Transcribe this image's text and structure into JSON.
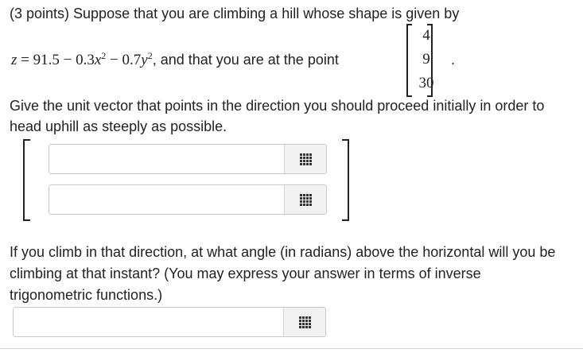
{
  "question": {
    "intro": "(3 points) Suppose that you are climbing a hill whose shape is given by",
    "equation": {
      "lhs": "z",
      "equals": " = 91.5 − 0.3",
      "var_x": "x",
      "exp_x": "2",
      "minus": " − 0.7",
      "var_y": "y",
      "exp_y": "2"
    },
    "point_text": ", and that you are at the point",
    "point": [
      "4",
      "9",
      "30"
    ],
    "point_end": ".",
    "prompt_line1": "Give the unit vector that points in the direction you should proceed initially in order to",
    "prompt_line2": "head uphill as steeply as possible.",
    "followup_line1": "If you climb in that direction, at what angle (in radians) above the horizontal will you be",
    "followup_line2": "climbing at that instant? (You may express your answer in terms of inverse",
    "followup_line3": "trigonometric functions.)"
  },
  "answers": {
    "vector_component_1": "",
    "vector_component_2": "",
    "angle": ""
  },
  "icons": {
    "keyboard_button": "grid-keypad-icon"
  }
}
